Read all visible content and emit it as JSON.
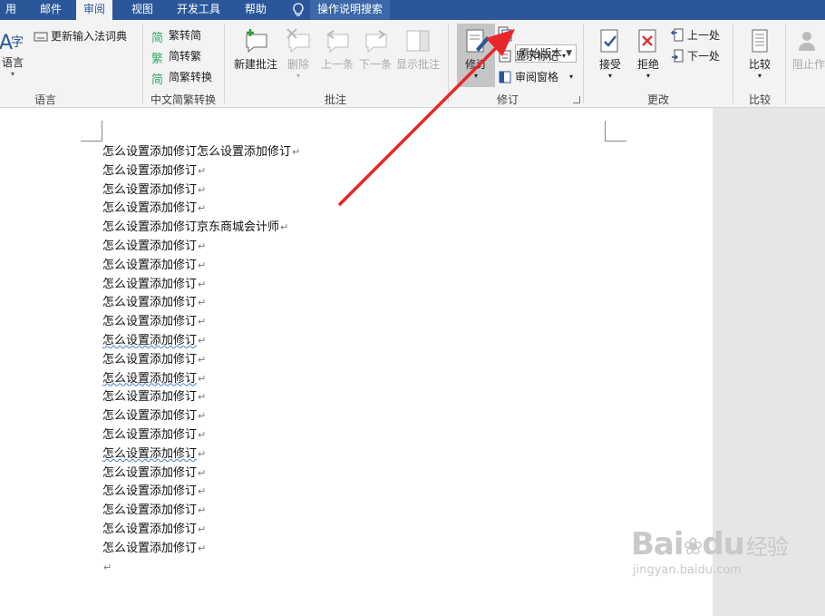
{
  "tabs": [
    {
      "label": "用"
    },
    {
      "label": "邮件"
    },
    {
      "label": "审阅"
    },
    {
      "label": "视图"
    },
    {
      "label": "开发工具"
    },
    {
      "label": "帮助"
    }
  ],
  "search": {
    "label": "操作说明搜索"
  },
  "ribbon": {
    "language": {
      "icon_text": "字",
      "button": "语言",
      "update_ime": "更新输入法词典",
      "group": "语言"
    },
    "chinese": {
      "t2s": "繁转简",
      "s2t": "简转繁",
      "convert": "简繁转换",
      "group": "中文简繁转换",
      "ic_t2s": "简",
      "ic_s2t": "繁",
      "ic_conv": "简"
    },
    "comments": {
      "new": "新建批注",
      "delete": "删除",
      "prev": "上一条",
      "next": "下一条",
      "show": "显示批注",
      "group": "批注"
    },
    "tracking": {
      "track": "修订",
      "display_for_review": "原始版本",
      "show_markup": "显示标记",
      "reviewing_pane": "审阅窗格",
      "group": "修订"
    },
    "changes": {
      "accept": "接受",
      "reject": "拒绝",
      "prev": "上一处",
      "next": "下一处",
      "group": "更改"
    },
    "compare": {
      "button": "比较",
      "group": "比较"
    },
    "protect": {
      "block": "阻止作"
    }
  },
  "document": {
    "pilcrow": "↵",
    "lines": [
      "怎么设置添加修订怎么设置添加修订",
      "怎么设置添加修订",
      "怎么设置添加修订",
      "怎么设置添加修订",
      "怎么设置添加修订京东商城会计师",
      "怎么设置添加修订",
      "怎么设置添加修订",
      "怎么设置添加修订",
      "怎么设置添加修订",
      "怎么设置添加修订",
      "怎么设置添加修订",
      "怎么设置添加修订",
      "怎么设置添加修订",
      "怎么设置添加修订",
      "怎么设置添加修订",
      "怎么设置添加修订",
      "怎么设置添加修订",
      "怎么设置添加修订",
      "怎么设置添加修订",
      "怎么设置添加修订",
      "怎么设置添加修订",
      "怎么设置添加修订",
      ""
    ]
  },
  "watermark": {
    "brand": "Bai",
    "brand2": "du",
    "brand3": "经验",
    "url": "jingyan.baidu.com"
  },
  "colors": {
    "accent": "#2b579a",
    "arrow": "#e8262a"
  }
}
